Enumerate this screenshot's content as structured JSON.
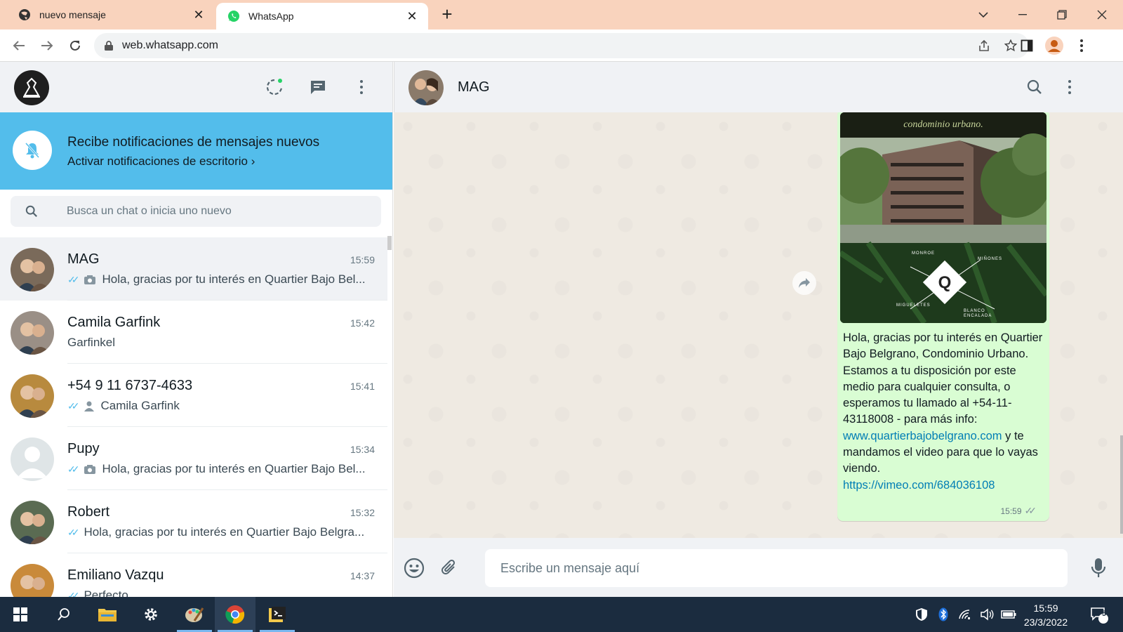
{
  "browser": {
    "tabs": [
      {
        "title": "nuevo mensaje",
        "active": false
      },
      {
        "title": "WhatsApp",
        "active": true
      }
    ],
    "url": "web.whatsapp.com"
  },
  "sidebar": {
    "notification": {
      "title": "Recibe notificaciones de mensajes nuevos",
      "action": "Activar notificaciones de escritorio"
    },
    "search_placeholder": "Busca un chat o inicia uno nuevo",
    "chats": [
      {
        "name": "MAG",
        "time": "15:59",
        "preview": "Hola, gracias por tu interés en Quartier Bajo Bel...",
        "ticks": "read",
        "attachment": "camera-icon",
        "selected": true,
        "avatar_color": "#7a6a5a"
      },
      {
        "name": "Camila Garfink",
        "time": "15:42",
        "preview": "Garfinkel",
        "ticks": "none",
        "attachment": "",
        "selected": false,
        "avatar_color": "#9a8f86"
      },
      {
        "name": "+54 9 11 6737-4633",
        "time": "15:41",
        "preview": "Camila Garfink",
        "ticks": "read",
        "attachment": "contact-icon",
        "selected": false,
        "avatar_color": "#b88a3e"
      },
      {
        "name": "Pupy",
        "time": "15:34",
        "preview": "Hola, gracias por tu interés en Quartier Bajo Bel...",
        "ticks": "read",
        "attachment": "camera-icon",
        "selected": false,
        "avatar_color": "#dfe5e7"
      },
      {
        "name": "Robert",
        "time": "15:32",
        "preview": "Hola, gracias por tu interés en Quartier Bajo Belgra...",
        "ticks": "read",
        "attachment": "",
        "selected": false,
        "avatar_color": "#5a6b52"
      },
      {
        "name": "Emiliano Vazqu",
        "time": "14:37",
        "preview": "Perfecto",
        "ticks": "read",
        "attachment": "",
        "selected": false,
        "avatar_color": "#c98a3a"
      }
    ]
  },
  "conversation": {
    "contact_name": "MAG",
    "image_caption": "condominio urbano.",
    "image_labels": {
      "top_left": "MONROE",
      "top_right": "MIÑONES",
      "bottom_left": "MIGUELETES",
      "bottom_right": "BLANCO ENCALADA"
    },
    "message": {
      "text_before_link": "Hola, gracias por tu interés en Quartier Bajo Belgrano, Condominio Urbano. Estamos a tu disposición por este medio para cualquier consulta, o esperamos tu llamado al +54-11-43118008  - para más info: ",
      "link1": "www.quartierbajobelgrano.com",
      "text_after_link": " y te mandamos el video para que lo vayas viendo.",
      "link2": "https://vimeo.com/684036108",
      "time": "15:59"
    },
    "composer_placeholder": "Escribe un mensaje aquí"
  },
  "taskbar": {
    "time": "15:59",
    "date": "23/3/2022",
    "notification_count": "5"
  },
  "colors": {
    "notification_banner": "#53bdeb",
    "outgoing_bubble": "#d9fdd3",
    "read_ticks": "#53bdeb",
    "link": "#027eb5",
    "chat_background": "#efeae2"
  }
}
